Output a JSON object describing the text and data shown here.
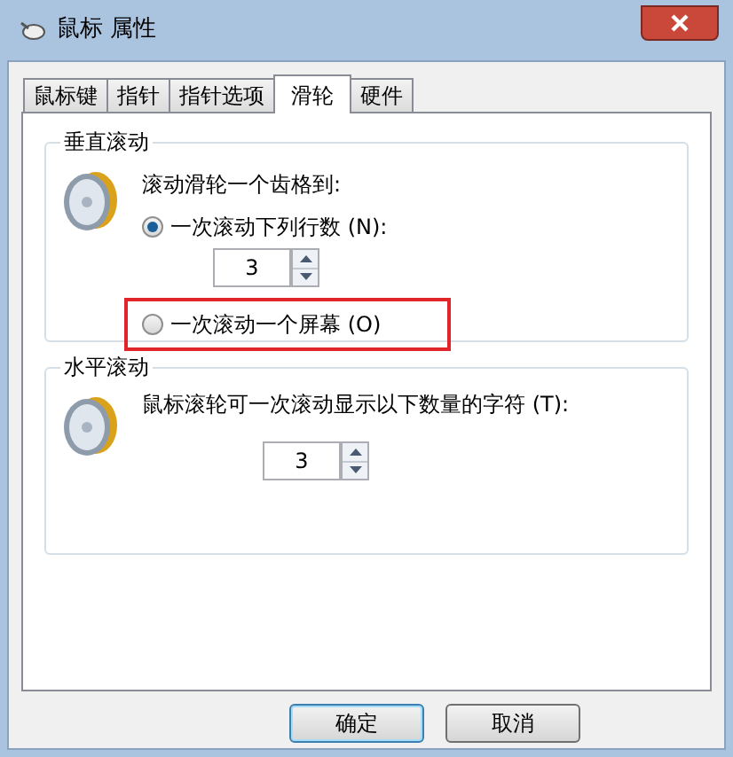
{
  "window": {
    "title": "鼠标 属性"
  },
  "tabs": [
    {
      "label": "鼠标键",
      "selected": false
    },
    {
      "label": "指针",
      "selected": false
    },
    {
      "label": "指针选项",
      "selected": false
    },
    {
      "label": "滑轮",
      "selected": true
    },
    {
      "label": "硬件",
      "selected": false
    }
  ],
  "vertical_scrolling": {
    "title": "垂直滚动",
    "prompt": "滚动滑轮一个齿格到:",
    "options": [
      {
        "label": "一次滚动下列行数 (N):",
        "selected": true,
        "highlighted": false
      },
      {
        "label": "一次滚动一个屏幕 (O)",
        "selected": false,
        "highlighted": true
      }
    ],
    "lines": "3"
  },
  "horizontal_scrolling": {
    "title": "水平滚动",
    "prompt": "鼠标滚轮可一次滚动显示以下数量的字符 (T):",
    "chars": "3"
  },
  "buttons": [
    "确定",
    "取消"
  ]
}
